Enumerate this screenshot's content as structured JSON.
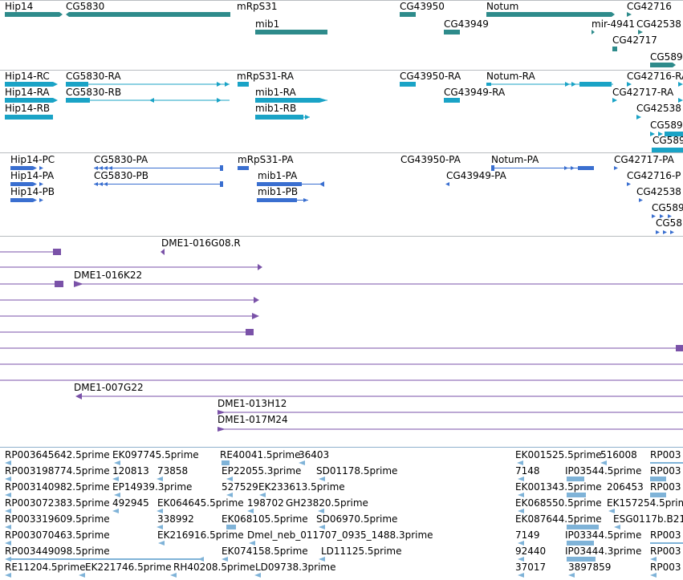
{
  "colors": {
    "track1": "#2e8b8b",
    "track2": "#1aa3c6",
    "track3": "#3a6fd0",
    "track4": "#7a52a8",
    "track5": "#7fb3d8",
    "separator": "#b8bcc0"
  },
  "tracks": {
    "genes": {
      "labels": [
        "Hip14",
        "CG5830",
        "mRpS31",
        "mib1",
        "CG43950",
        "CG43949",
        "Notum",
        "CG42716",
        "mir-4941",
        "CG42538",
        "CG42717",
        "CG589"
      ]
    },
    "transcripts_ra": {
      "labels": [
        "Hip14-RC",
        "CG5830-RA",
        "mRpS31-RA",
        "CG43950-RA",
        "Notum-RA",
        "CG42716-RA",
        "Hip14-RA",
        "CG5830-RB",
        "mib1-RA",
        "CG43949-RA",
        "CG42717-RA",
        "Hip14-RB",
        "mib1-RB",
        "CG42538",
        "CG589",
        "CG589"
      ]
    },
    "proteins": {
      "labels": [
        "Hip14-PC",
        "CG5830-PA",
        "mRpS31-PA",
        "CG43950-PA",
        "Notum-PA",
        "CG42717-PA",
        "Hip14-PA",
        "CG5830-PB",
        "mib1-PA",
        "CG43949-PA",
        "CG42716-P",
        "Hip14-PB",
        "mib1-PB",
        "CG42538",
        "CG589",
        "CG58"
      ]
    },
    "clones": {
      "labels": [
        "DME1-016G08.R",
        "DME1-016K22",
        "DME1-007G22",
        "DME1-013H12",
        "DME1-017M24"
      ]
    },
    "ests": {
      "rows": [
        [
          "RP003645642.5prime",
          "EK097745.5prime",
          "RE40041.5prime",
          "36403",
          "EK001525.5prime",
          "516008",
          "RP003"
        ],
        [
          "RP003198774.5prime",
          "120813",
          "73858",
          "EP22055.3prime",
          "SD01178.5prime",
          "7148",
          "IP03544.5prime",
          "RP003"
        ],
        [
          "RP003140982.5prime",
          "EP14939.3prime",
          "527529",
          "EK233613.5prime",
          "EK001343.5prime",
          "206453",
          "RP003"
        ],
        [
          "RP003072383.5prime",
          "492945",
          "EK064645.5prime",
          "198702",
          "GH23820.5prime",
          "EK068550.5prime",
          "EK157254.5prime"
        ],
        [
          "RP003319609.5prime",
          "338992",
          "EK068105.5prime",
          "SD06970.5prime",
          "EK087644.5prime",
          "ESG0117b.B21"
        ],
        [
          "RP003070463.5prime",
          "EK216916.5prime",
          "Dmel_neb_011707_0935_1488.3prime",
          "7149",
          "IP03344.5prime",
          "RP003"
        ],
        [
          "RP003449098.5prime",
          "EK074158.5prime",
          "LD11125.5prime",
          "92440",
          "IP03444.3prime",
          "RP003"
        ],
        [
          "RE11204.5prime",
          "EK221746.5prime",
          "RH40208.5prime",
          "LD09738.3prime",
          "37017",
          "3897859",
          "RP003"
        ]
      ]
    }
  }
}
